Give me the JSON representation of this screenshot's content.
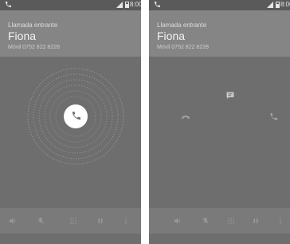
{
  "status_bar": {
    "time": "8:00"
  },
  "screens": [
    {
      "call_status": "Llamada entrante",
      "caller_name": "Fiona",
      "caller_number": "Móvil 0752 822 8228"
    },
    {
      "call_status": "Llamada entrante",
      "caller_name": "Fiona",
      "caller_number": "Móvil 0752 822 8228"
    }
  ],
  "icons": {
    "status": [
      "phone-icon",
      "signal-icon",
      "battery-icon"
    ],
    "answer": "phone-handset-icon",
    "targets": [
      "message-icon",
      "decline-icon",
      "answer-icon"
    ],
    "bottom_bar": [
      "speaker-icon",
      "mute-icon",
      "dialpad-icon",
      "hold-icon",
      "more-icon"
    ]
  },
  "colors": {
    "background": "#6e6e6e",
    "header": "#858585",
    "status_bar": "#5a5a5a",
    "bottom_bar": "#7a7a7a",
    "answer_button": "#ffffff"
  }
}
